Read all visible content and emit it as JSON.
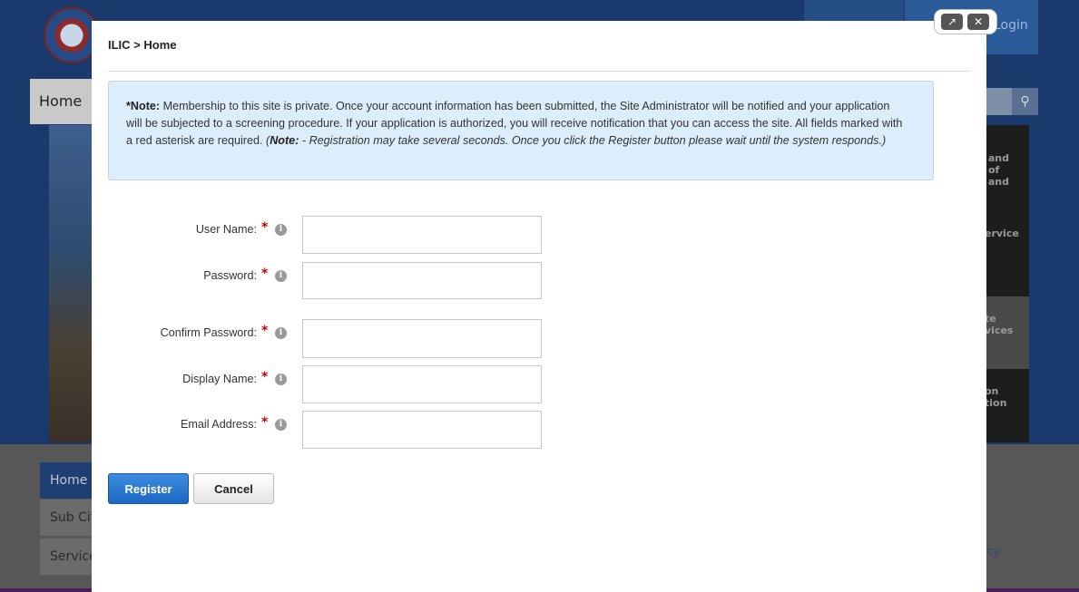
{
  "background": {
    "home_tab": "Home",
    "login_label": "Login",
    "search_icon": "search-icon",
    "side_panels": [
      [
        "and",
        "of",
        "and"
      ],
      [
        "ervice"
      ],
      [
        "te",
        "vices"
      ],
      [
        "on",
        "tion"
      ]
    ],
    "left_nav": [
      "Home",
      "Sub Cit",
      "Service"
    ],
    "footer_link": "cy"
  },
  "modal": {
    "breadcrumb": "ILIC > Home",
    "controls": {
      "expand_icon": "expand-icon",
      "close_icon": "close-icon"
    },
    "note": {
      "lead": "*Note:",
      "body": " Membership to this site is private. Once your account information has been submitted, the Site Administrator will be notified and your application will be subjected to a screening procedure. If your application is authorized, you will receive notification that you can access the site. All fields marked with a red asterisk are required. ",
      "italic_open": "(",
      "italic_lead": "Note:",
      "italic_body": " - Registration may take several seconds. Once you click the Register button please wait until the system responds.)"
    },
    "form": {
      "required_marker": "*",
      "info_glyph": "i",
      "fields": [
        {
          "label": "User Name:",
          "value": "",
          "placeholder": ""
        },
        {
          "label": "Password:",
          "value": "",
          "placeholder": ""
        },
        {
          "label": "Confirm Password:",
          "value": "",
          "placeholder": ""
        },
        {
          "label": "Display Name:",
          "value": "",
          "placeholder": ""
        },
        {
          "label": "Email Address:",
          "value": "",
          "placeholder": ""
        }
      ]
    },
    "buttons": {
      "register": "Register",
      "cancel": "Cancel"
    }
  },
  "colors": {
    "primary_button": "#1b67c2",
    "note_background": "#dcedfc",
    "required": "#cc0000"
  }
}
